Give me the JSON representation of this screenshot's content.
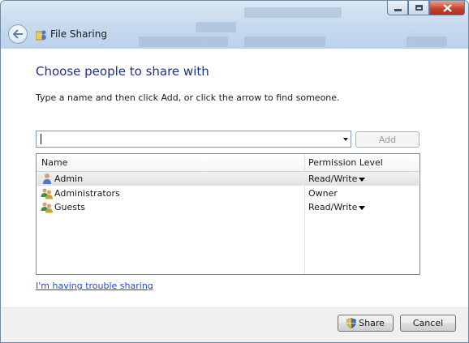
{
  "window": {
    "title": "File Sharing"
  },
  "content": {
    "heading": "Choose people to share with",
    "instruction": "Type a name and then click Add, or click the arrow to find someone.",
    "name_input": {
      "value": "",
      "placeholder": ""
    },
    "add_label": "Add"
  },
  "list": {
    "columns": {
      "name": "Name",
      "permission": "Permission Level"
    },
    "rows": [
      {
        "name": "Admin",
        "permission": "Read/Write",
        "has_dropdown": true,
        "selected": true,
        "icon": "single-user-icon"
      },
      {
        "name": "Administrators",
        "permission": "Owner",
        "has_dropdown": false,
        "selected": false,
        "icon": "group-users-icon"
      },
      {
        "name": "Guests",
        "permission": "Read/Write",
        "has_dropdown": true,
        "selected": false,
        "icon": "group-users-icon"
      }
    ]
  },
  "trouble_link": "I'm having trouble sharing",
  "footer": {
    "share_label": "Share",
    "cancel_label": "Cancel"
  },
  "colors": {
    "heading": "#1e3287",
    "link": "#1c4fbf",
    "titlebar": "#c9dbee",
    "close_button": "#c8442e"
  }
}
